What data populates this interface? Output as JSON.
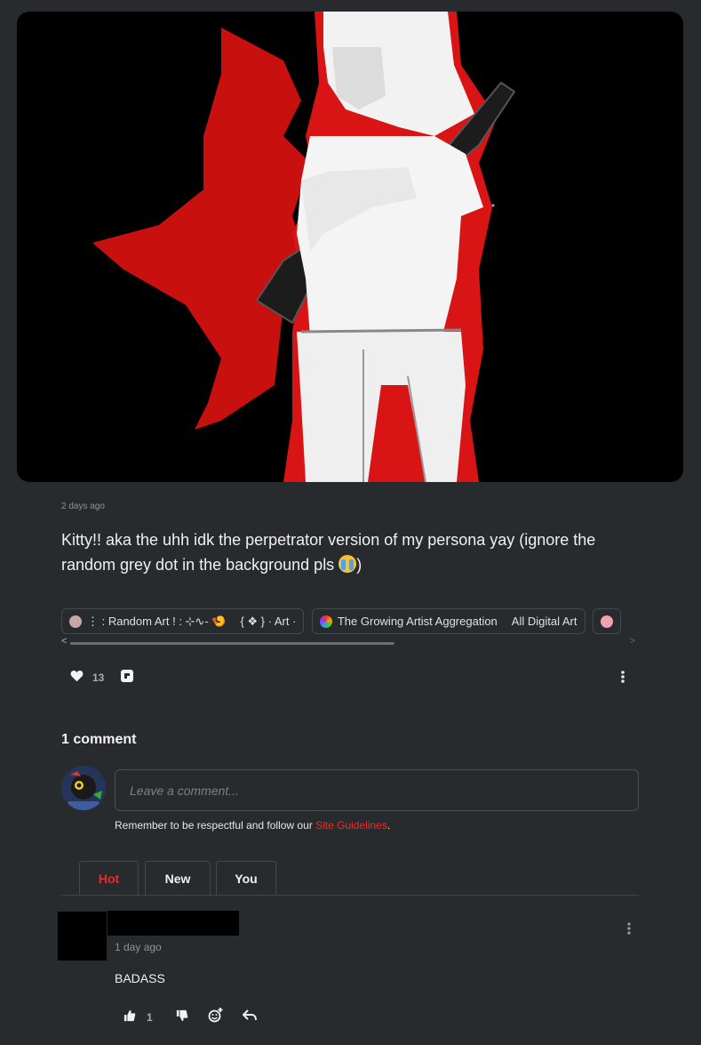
{
  "post": {
    "timestamp": "2 days ago",
    "caption": "Kitty!! aka the uhh idk the perpetrator version of my persona yay (ignore the random grey dot in the background pls",
    "caption_end": ")",
    "like_count": "13"
  },
  "tags": [
    {
      "chips": [
        {
          "icon": "avatar-icon",
          "label": "⋮ : Random Art ! : ⊹∿- 🍤"
        },
        {
          "label": "{ ❖ } · Art ·"
        }
      ]
    },
    {
      "chips": [
        {
          "icon": "palette-icon",
          "label": "The Growing Artist Aggregation"
        },
        {
          "label": "All Digital Art"
        }
      ]
    },
    {
      "chips": [
        {
          "icon": "pink-avatar-icon",
          "label": ""
        }
      ]
    }
  ],
  "comments": {
    "title": "1 comment",
    "input_placeholder": "Leave a comment...",
    "guidelines_text": "Remember to be respectful and follow our ",
    "guidelines_link": "Site Guidelines",
    "guidelines_end": ".",
    "sort_tabs": [
      "Hot",
      "New",
      "You"
    ],
    "active_tab": "Hot",
    "items": [
      {
        "time": "1 day ago",
        "text": "BADASS",
        "upvotes": "1"
      }
    ]
  },
  "colors": {
    "background": "#282b2e",
    "accent": "#ee2a2a",
    "art_red": "#c8100f"
  }
}
